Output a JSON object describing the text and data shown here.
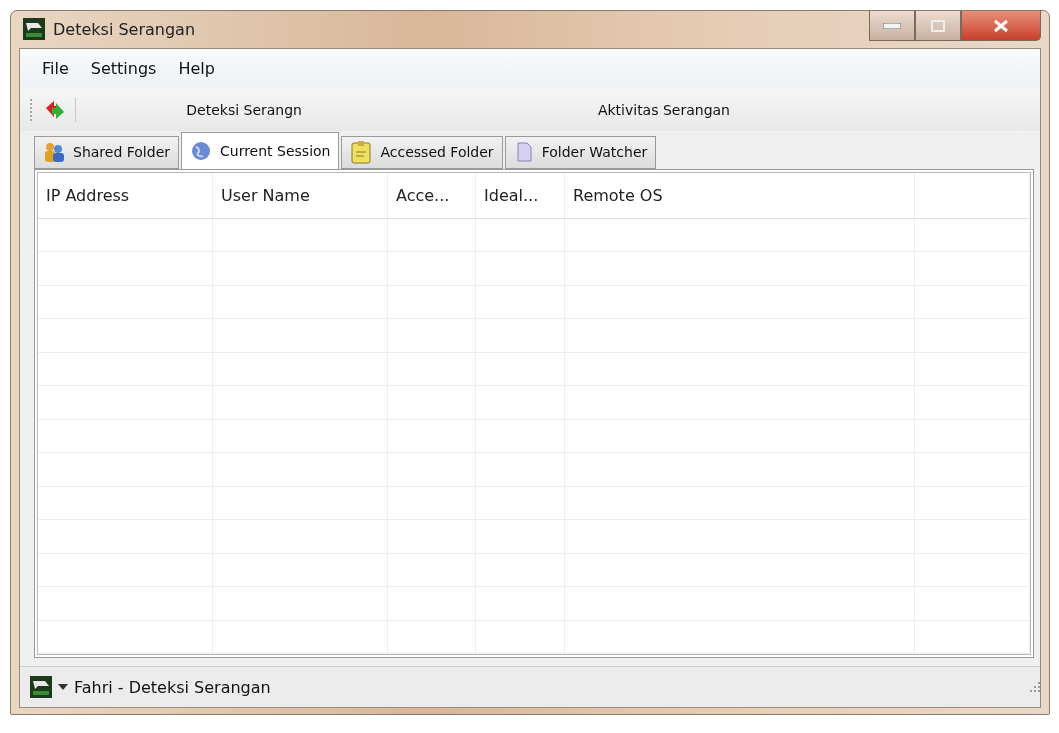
{
  "window": {
    "title": "Deteksi Serangan"
  },
  "menu": [
    "File",
    "Settings",
    "Help"
  ],
  "toolbar": {
    "labels": [
      "Deteksi Serangn",
      "Aktivitas Serangan"
    ]
  },
  "tabs": [
    {
      "label": "Shared Folder",
      "selected": false,
      "kind": "people"
    },
    {
      "label": "Current Session",
      "selected": true,
      "kind": "globe"
    },
    {
      "label": "Accessed Folder",
      "selected": false,
      "kind": "note"
    },
    {
      "label": "Folder Watcher",
      "selected": false,
      "kind": "document"
    }
  ],
  "table": {
    "columns": [
      "IP Address",
      "User Name",
      "Acce...",
      "Ideal...",
      "Remote OS"
    ]
  },
  "status_bar": {
    "text": "Fahri - Deteksi Serangan"
  }
}
